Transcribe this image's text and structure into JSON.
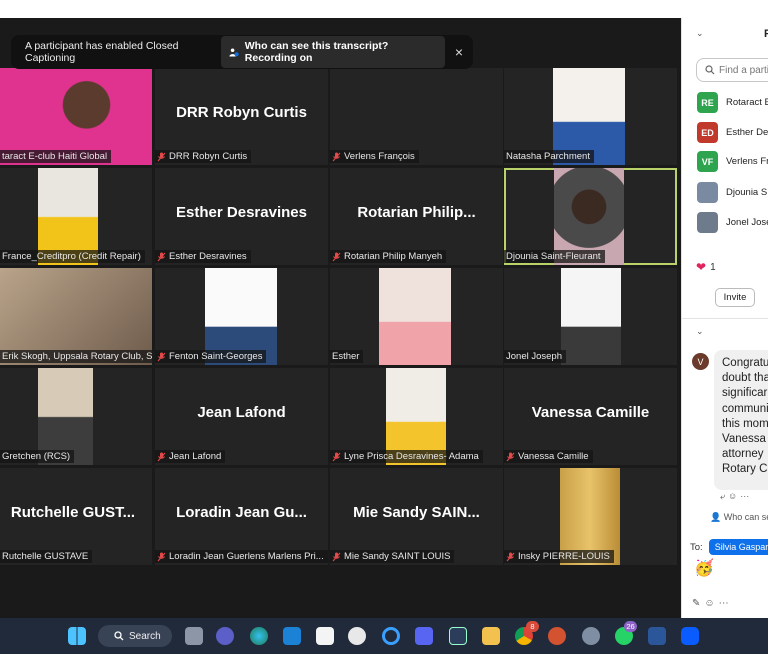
{
  "caption_bar": {
    "message": "A participant has enabled Closed Captioning",
    "transcript_button": "Who can see this transcript? Recording on",
    "close_label": "×"
  },
  "tiles": [
    {
      "label": "taract E-club Haiti Global",
      "big": "",
      "muted": false,
      "video": "pink"
    },
    {
      "label": "DRR Robyn Curtis",
      "big": "DRR Robyn Curtis",
      "muted": true
    },
    {
      "label": "Verlens François",
      "big": "",
      "muted": true
    },
    {
      "label": "Natasha Parchment",
      "big": "",
      "muted": false,
      "video": "office"
    },
    {
      "label": "France_Creditpro (Credit Repair)",
      "big": "",
      "muted": false,
      "video": "yellow"
    },
    {
      "label": "Esther Desravines",
      "big": "Esther Desravines",
      "muted": true
    },
    {
      "label": "Rotarian Philip Manyeh",
      "big": "Rotarian  Philip...",
      "muted": true
    },
    {
      "label": "Djounia Saint-Fleurant",
      "big": "",
      "muted": false,
      "video": "car",
      "active": true
    },
    {
      "label": "Erik Skogh, Uppsala Rotary Club, S...",
      "big": "",
      "muted": false,
      "video": "room"
    },
    {
      "label": "Fenton Saint-Georges",
      "big": "",
      "muted": true,
      "video": "white"
    },
    {
      "label": "Esther",
      "big": "",
      "muted": false,
      "video": "pink2"
    },
    {
      "label": "Jonel Joseph",
      "big": "",
      "muted": false,
      "video": "white2"
    },
    {
      "label": "Gretchen (RCS)",
      "big": "",
      "muted": false,
      "video": "beige"
    },
    {
      "label": "Jean Lafond",
      "big": "Jean Lafond",
      "muted": true
    },
    {
      "label": "Lyne Prisca Desravines- Adama",
      "big": "",
      "muted": true,
      "video": "yellow2"
    },
    {
      "label": "Vanessa Camille",
      "big": "Vanessa Camille",
      "muted": true
    },
    {
      "label": "Rutchelle GUSTAVE",
      "big": "Rutchelle  GUST...",
      "muted": false
    },
    {
      "label": "Loradin Jean Guerlens Marlens Pri...",
      "big": "Loradin Jean Gu...",
      "muted": true
    },
    {
      "label": "Mie Sandy SAINT LOUIS",
      "big": "Mie Sandy SAIN...",
      "muted": true
    },
    {
      "label": "Insky PIERRE-LOUIS",
      "big": "",
      "muted": true,
      "video": "gold"
    }
  ],
  "panel": {
    "header_letter": "F",
    "search_placeholder": "Find a partic",
    "participants": [
      {
        "initials": "RE",
        "name": "Rotaract E",
        "color": "#2ea44f"
      },
      {
        "initials": "ED",
        "name": "Esther Des",
        "color": "#c0392b"
      },
      {
        "initials": "VF",
        "name": "Verlens Fr",
        "color": "#2ea44f"
      },
      {
        "initials": "",
        "name": "Djounia S",
        "color": "#7a8aa0"
      },
      {
        "initials": "",
        "name": "Jonel Jose",
        "color": "#6d7b8c"
      }
    ],
    "reaction_count": "1",
    "invite_label": "Invite",
    "message_avatar": "V",
    "message_lines": [
      "Congratu",
      "doubt tha",
      "significar",
      "communi",
      "this mom",
      "Vanessa A",
      "attorney",
      "Rotary Cl"
    ],
    "who_can_see": "Who can se",
    "to_label": "To:",
    "to_recipient": "Silvia Gaspard"
  },
  "taskbar": {
    "search_label": "Search",
    "badge_chrome": "8",
    "badge_whatsapp": "26"
  }
}
